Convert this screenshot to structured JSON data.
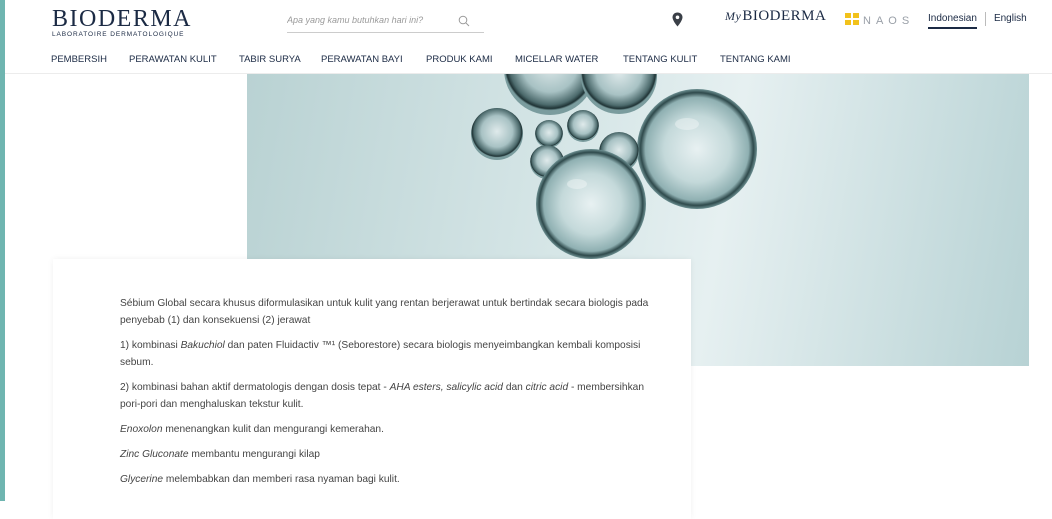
{
  "brand": {
    "name": "BIODERMA",
    "tagline": "LABORATOIRE DERMATOLOGIQUE"
  },
  "search": {
    "placeholder": "Apa yang kamu butuhkan hari ini?"
  },
  "header": {
    "mybioderma_prefix": "My",
    "mybioderma_name": "BIODERMA",
    "naos": "NAOS",
    "languages": [
      "Indonesian",
      "English"
    ],
    "active_language": "Indonesian"
  },
  "nav": {
    "items": [
      "PEMBERSIH",
      "PERAWATAN KULIT",
      "TABIR SURYA",
      "PERAWATAN BAYI",
      "PRODUK KAMI",
      "MICELLAR WATER",
      "TENTANG KULIT",
      "TENTANG KAMI"
    ]
  },
  "content": {
    "p1": "Sébium Global secara khusus diformulasikan untuk kulit yang rentan berjerawat untuk bertindak secara biologis pada penyebab (1) dan konsekuensi (2) jerawat",
    "p2_a": "1) kombinasi ",
    "p2_em": "Bakuchiol",
    "p2_b": " dan paten Fluidactiv ™¹ (Seborestore) secara biologis menyeimbangkan kembali komposisi sebum.",
    "p3_a": "2) kombinasi bahan aktif dermatologis dengan dosis tepat - ",
    "p3_em1": "AHA esters, salicylic acid",
    "p3_b": " dan ",
    "p3_em2": "citric acid",
    "p3_c": " - membersihkan pori-pori dan menghaluskan tekstur kulit.",
    "p4_em": "Enoxolon",
    "p4_b": " menenangkan kulit dan mengurangi kemerahan.",
    "p5_em": "Zinc Gluconate",
    "p5_b": " membantu mengurangi kilap",
    "p6_em": "Glycerine",
    "p6_b": " melembabkan dan memberi rasa nyaman bagi kulit."
  },
  "colors": {
    "brand_navy": "#1b2a44",
    "left_rail": "#6fb5b0",
    "naos_yellow": "#f2c21b"
  },
  "icons": {
    "search": "search-icon",
    "location": "location-pin-icon",
    "naos": "naos-logo-icon"
  }
}
